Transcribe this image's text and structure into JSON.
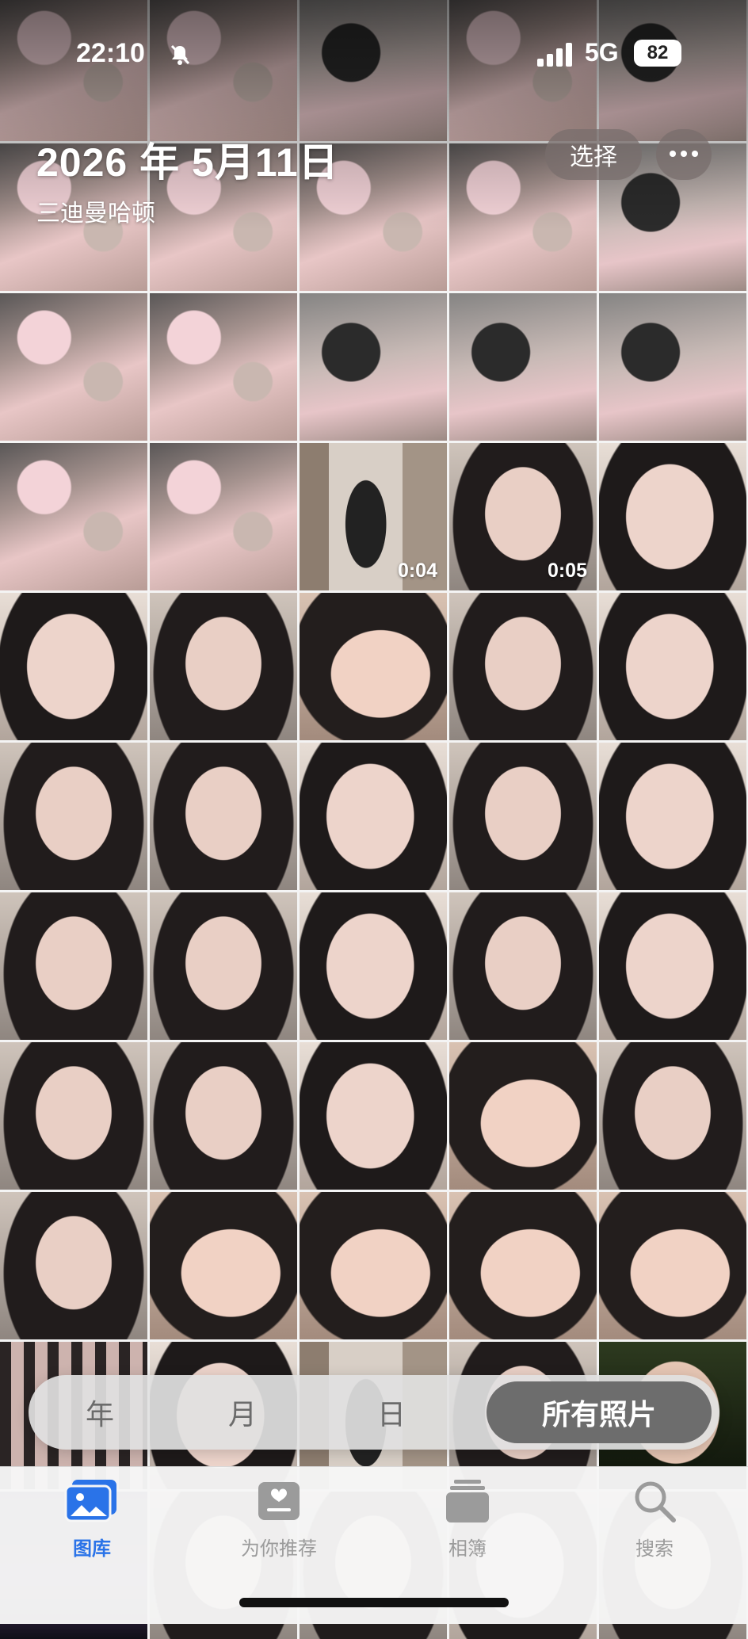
{
  "status_bar": {
    "time": "22:10",
    "network": "5G",
    "battery": "82"
  },
  "header": {
    "date": "2026 年 5月11日",
    "location": "三迪曼哈顿",
    "select_label": "选择"
  },
  "grid": {
    "tiles": [
      "t-desk",
      "t-desk",
      "t-desk2",
      "t-desk",
      "t-desk2",
      "t-desk",
      "t-desk",
      "t-desk",
      "t-desk",
      "t-desk2",
      "t-desk",
      "t-desk",
      "t-desk2",
      "t-desk2",
      "t-desk2",
      "t-desk",
      "t-desk",
      "t-room",
      "t-face",
      "t-face2",
      "t-face2",
      "t-face",
      "t-face3",
      "t-face",
      "t-face2",
      "t-face",
      "t-face",
      "t-face2",
      "t-face",
      "t-face2",
      "t-face",
      "t-face",
      "t-face2",
      "t-face",
      "t-face2",
      "t-face",
      "t-face",
      "t-face2",
      "t-face3",
      "t-face",
      "t-face",
      "t-face3",
      "t-face3",
      "t-face3",
      "t-face3",
      "t-collage",
      "t-face2",
      "t-room",
      "t-face",
      "t-night",
      "t-city",
      "t-face",
      "t-face",
      "t-face2",
      "t-face"
    ],
    "durations": {
      "17": "0:04",
      "18": "0:05"
    }
  },
  "segments": {
    "year": "年",
    "month": "月",
    "day": "日",
    "all": "所有照片"
  },
  "tabs": {
    "library": "图库",
    "for_you": "为你推荐",
    "albums": "相簿",
    "search": "搜索"
  },
  "colors": {
    "accent": "#2a73e8",
    "inactive": "#9b9b9b"
  }
}
